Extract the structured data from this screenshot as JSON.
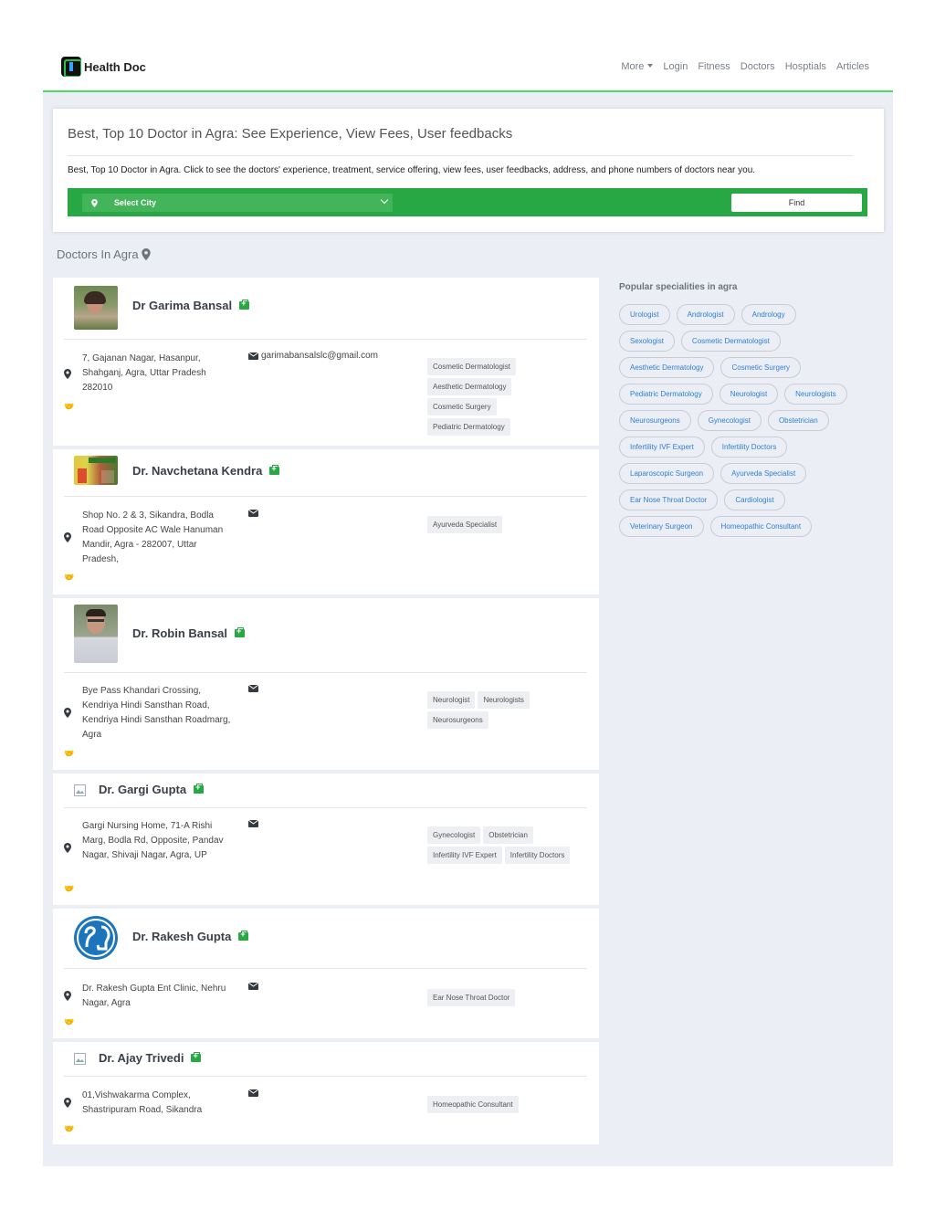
{
  "brand": {
    "name": "Health Doc"
  },
  "nav": {
    "items": [
      "More",
      "Login",
      "Fitness",
      "Doctors",
      "Hosptials",
      "Articles"
    ]
  },
  "hero": {
    "title": "Best, Top 10 Doctor in Agra: See Experience, View Fees, User feedbacks",
    "description": "Best, Top 10 Doctor in Agra. Click to see the doctors' experience, treatment, service offering, view fees, user feedbacks, address, and phone numbers of doctors near you.",
    "city_select": "Select City",
    "find_label": "Find"
  },
  "section_title": "Doctors In Agra",
  "doctors": [
    {
      "name": "Dr Garima Bansal",
      "address": "7, Gajanan Nagar, Hasanpur, Shahganj, Agra, Uttar Pradesh 282010",
      "email": "garimabansalslc@gmail.com",
      "tags": [
        "Cosmetic Dermatologist",
        "Aesthetic Dermatology",
        "Cosmetic Surgery",
        "Pediatric Dermatology"
      ]
    },
    {
      "name": "Dr. Navchetana Kendra",
      "address": "Shop No. 2 & 3, Sikandra, Bodla Road Opposite AC Wale Hanuman Mandir, Agra - 282007, Uttar Pradesh,",
      "email": "",
      "tags": [
        "Ayurveda Specialist"
      ]
    },
    {
      "name": "Dr. Robin Bansal",
      "address": "Bye Pass Khandari Crossing, Kendriya Hindi Sansthan Road, Kendriya Hindi Sansthan Roadmarg, Agra",
      "email": "",
      "tags": [
        "Neurologist",
        "Neurologists",
        "Neurosurgeons"
      ]
    },
    {
      "name": "Dr. Gargi Gupta",
      "address": "Gargi Nursing Home, 71-A Rishi Marg, Bodla Rd, Opposite, Pandav Nagar, Shivaji Nagar, Agra, UP",
      "email": "",
      "tags": [
        "Gynecologist",
        "Obstetrician",
        "Infertility IVF Expert",
        "Infertility Doctors"
      ]
    },
    {
      "name": "Dr. Rakesh Gupta",
      "address": "Dr. Rakesh Gupta Ent Clinic, Nehru Nagar, Agra",
      "email": "",
      "tags": [
        "Ear Nose Throat Doctor"
      ]
    },
    {
      "name": "Dr. Ajay Trivedi",
      "address": "01,Vishwakarma Complex, Shastripuram Road, Sikandra",
      "email": "",
      "tags": [
        "Homeopathic Consultant"
      ]
    }
  ],
  "sidebar": {
    "title": "Popular specialities in agra",
    "items": [
      "Urologist",
      "Andrologist",
      "Andrology",
      "Sexologist",
      "Cosmetic Dermatologist",
      "Aesthetic Dermatology",
      "Cosmetic Surgery",
      "Pediatric Dermatology",
      "Neurologist",
      "Neurologists",
      "Neurosurgeons",
      "Gynecologist",
      "Obstetrician",
      "Infertility IVF Expert",
      "Infertility Doctors",
      "Laparoscopic Surgeon",
      "Ayurveda Specialist",
      "Ear Nose Throat Doctor",
      "Cardiologist",
      "Veterinary Surgeon",
      "Homeopathic Consultant"
    ]
  },
  "colors": {
    "accent": "#28a745",
    "link": "#2d7fd3",
    "bg": "#eceef5"
  }
}
